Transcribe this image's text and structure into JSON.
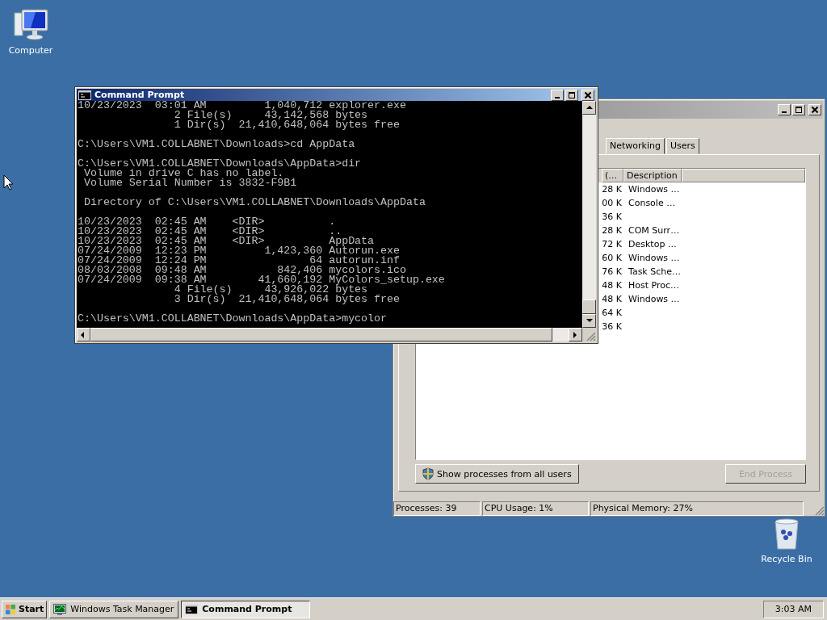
{
  "desktop_icons": [
    {
      "label": "Computer",
      "kind": "computer"
    },
    {
      "label": "Recycle Bin",
      "kind": "recycle_bin"
    }
  ],
  "task_manager": {
    "tabs": [
      {
        "label": "Networking",
        "selected": false
      },
      {
        "label": "Users",
        "selected": false
      }
    ],
    "columns": [
      "(…",
      "Description"
    ],
    "rows": [
      {
        "column_1": "28 K",
        "description": "Windows …"
      },
      {
        "column_1": "00 K",
        "description": "Console …"
      },
      {
        "column_1": "36 K"
      },
      {
        "column_1": "28 K",
        "description": "COM Surr…"
      },
      {
        "column_1": "72 K",
        "description": "Desktop …"
      },
      {
        "column_1": "60 K",
        "description": "Windows …"
      },
      {
        "column_1": "76 K",
        "description": "Task Sche…"
      },
      {
        "column_1": "48 K",
        "description": "Host Proc…"
      },
      {
        "column_1": "48 K",
        "description": "Windows …"
      },
      {
        "column_1": "64 K"
      },
      {
        "column_1": "36 K"
      }
    ],
    "show_all_button": "Show processes from all users",
    "end_process_button": {
      "label": "End Process",
      "disabled": true
    },
    "status_bar": [
      "Processes: 39",
      "CPU Usage: 1%",
      "Physical Memory: 27%"
    ]
  },
  "command_prompt": {
    "title": "Command Prompt",
    "blocks": [
      [
        "10/23/2023  03:01 AM         1,040,712 explorer.exe",
        "               2 File(s)     43,142,568 bytes",
        "               1 Dir(s)  21,410,648,064 bytes free"
      ],
      [
        "C:\\Users\\VM1.COLLABNET\\Downloads>cd AppData"
      ],
      [
        "C:\\Users\\VM1.COLLABNET\\Downloads\\AppData>dir",
        " Volume in drive C has no label.",
        " Volume Serial Number is 3832-F9B1"
      ],
      [
        " Directory of C:\\Users\\VM1.COLLABNET\\Downloads\\AppData"
      ],
      [
        "10/23/2023  02:45 AM    <DIR>          .",
        "10/23/2023  02:45 AM    <DIR>          ..",
        "10/23/2023  02:45 AM    <DIR>          AppData",
        "07/24/2009  12:23 PM         1,423,360 Autorun.exe",
        "07/24/2009  12:24 PM                64 autorun.inf",
        "08/03/2008  09:48 AM           842,406 mycolors.ico",
        "07/24/2009  09:38 AM        41,660,192 MyColors_setup.exe",
        "               4 File(s)     43,926,022 bytes",
        "               3 Dir(s)  21,410,648,064 bytes free"
      ],
      [
        "C:\\Users\\VM1.COLLABNET\\Downloads\\AppData>mycolor"
      ]
    ]
  },
  "taskbar": {
    "start": "Start",
    "tasks": [
      {
        "label": "Windows Task Manager",
        "kind": "task_manager",
        "selected": false
      },
      {
        "label": "Command Prompt",
        "kind": "console",
        "selected": true
      }
    ],
    "clock": "3:03 AM"
  }
}
